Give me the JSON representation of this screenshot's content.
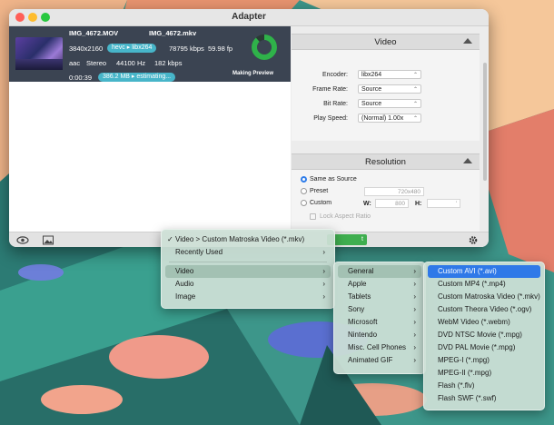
{
  "window": {
    "title": "Adapter"
  },
  "file": {
    "input_name": "IMG_4672.MOV",
    "output_name": "IMG_4672.mkv",
    "resolution": "3840x2160",
    "codec_pill": "hevc ▸ libx264",
    "bitrate_video": "78795 kbps",
    "fps": "59.98 fp",
    "audio_codec": "aac",
    "channels": "Stereo",
    "sample_rate": "44100 Hz",
    "bitrate_audio": "182 kbps",
    "duration": "0:00:39",
    "size_pill": "386.2 MB ▸ estimating...",
    "status": "Making Preview",
    "progress": 0.88
  },
  "video_section": {
    "title": "Video",
    "encoder_label": "Encoder:",
    "encoder_value": "libx264",
    "framerate_label": "Frame Rate:",
    "framerate_value": "Source",
    "bitrate_label": "Bit Rate:",
    "bitrate_value": "Source",
    "playspeed_label": "Play Speed:",
    "playspeed_value": "(Normal) 1.00x"
  },
  "resolution_section": {
    "title": "Resolution",
    "same_as_source": "Same as Source",
    "preset": "Preset",
    "preset_value": "720x480",
    "custom": "Custom",
    "w_label": "W:",
    "w_value": "800",
    "h_label": "H:",
    "h_value": "'",
    "lock_aspect": "Lock Aspect Ratio"
  },
  "toolbar": {
    "convert_label": "t"
  },
  "menu_main": {
    "checked": "Video > Custom Matroska Video (*.mkv)",
    "recent": "Recently Used",
    "items": [
      "Video",
      "Audio",
      "Image"
    ]
  },
  "menu_video": [
    "General",
    "Apple",
    "Tablets",
    "Sony",
    "Microsoft",
    "Nintendo",
    "Misc. Cell Phones",
    "Animated GIF"
  ],
  "menu_general": [
    "Custom AVI (*.avi)",
    "Custom MP4 (*.mp4)",
    "Custom Matroska Video (*.mkv)",
    "Custom Theora Video (*.ogv)",
    "WebM Video (*.webm)",
    "DVD NTSC Movie (*.mpg)",
    "DVD PAL Movie (*.mpg)",
    "MPEG-I (*.mpg)",
    "MPEG-II (*.mpg)",
    "Flash (*.flv)",
    "Flash SWF (*.swf)"
  ],
  "colors": {
    "accent": "#2f79e8",
    "progress": "#2fb24a",
    "pill": "#47b5c9"
  },
  "icons": {
    "preview": "eye-icon",
    "image": "picture-icon",
    "settings": "gear-icon"
  }
}
